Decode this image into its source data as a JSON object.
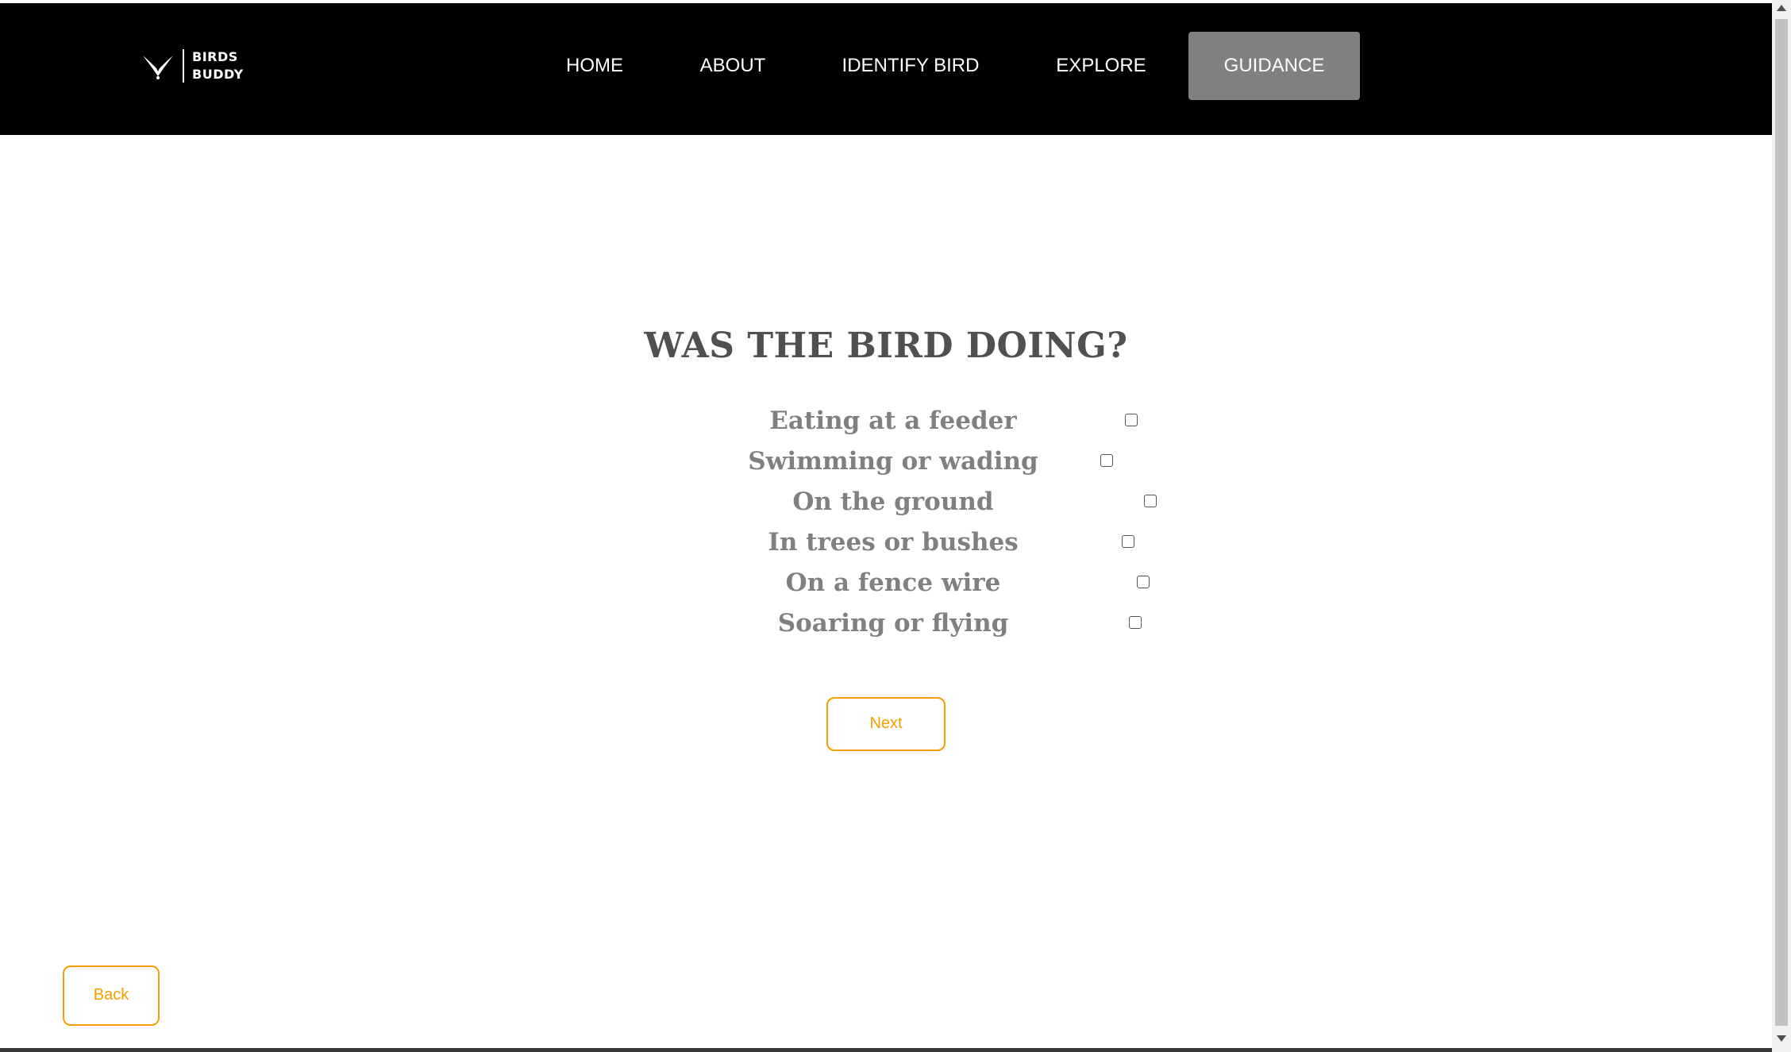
{
  "header": {
    "logo": {
      "line1": "BIRDS",
      "line2": "BUDDY",
      "icon": "bird-logo-icon"
    },
    "nav": [
      {
        "label": "HOME",
        "active": false
      },
      {
        "label": "ABOUT",
        "active": false
      },
      {
        "label": "IDENTIFY BIRD",
        "active": false
      },
      {
        "label": "EXPLORE",
        "active": false
      },
      {
        "label": "GUIDANCE",
        "active": true
      }
    ]
  },
  "main": {
    "question": "WAS THE BIRD DOING?",
    "options": [
      {
        "label": "Eating at a feeder",
        "checked": false
      },
      {
        "label": "Swimming or wading",
        "checked": false
      },
      {
        "label": "On the ground",
        "checked": false
      },
      {
        "label": "In trees or bushes",
        "checked": false
      },
      {
        "label": "On a fence wire",
        "checked": false
      },
      {
        "label": "Soaring or flying",
        "checked": false
      }
    ],
    "next_label": "Next",
    "back_label": "Back"
  },
  "colors": {
    "nav_background": "#000000",
    "nav_active": "#808080",
    "accent": "#f5a000",
    "title_text": "#505050",
    "option_text": "#808080"
  }
}
